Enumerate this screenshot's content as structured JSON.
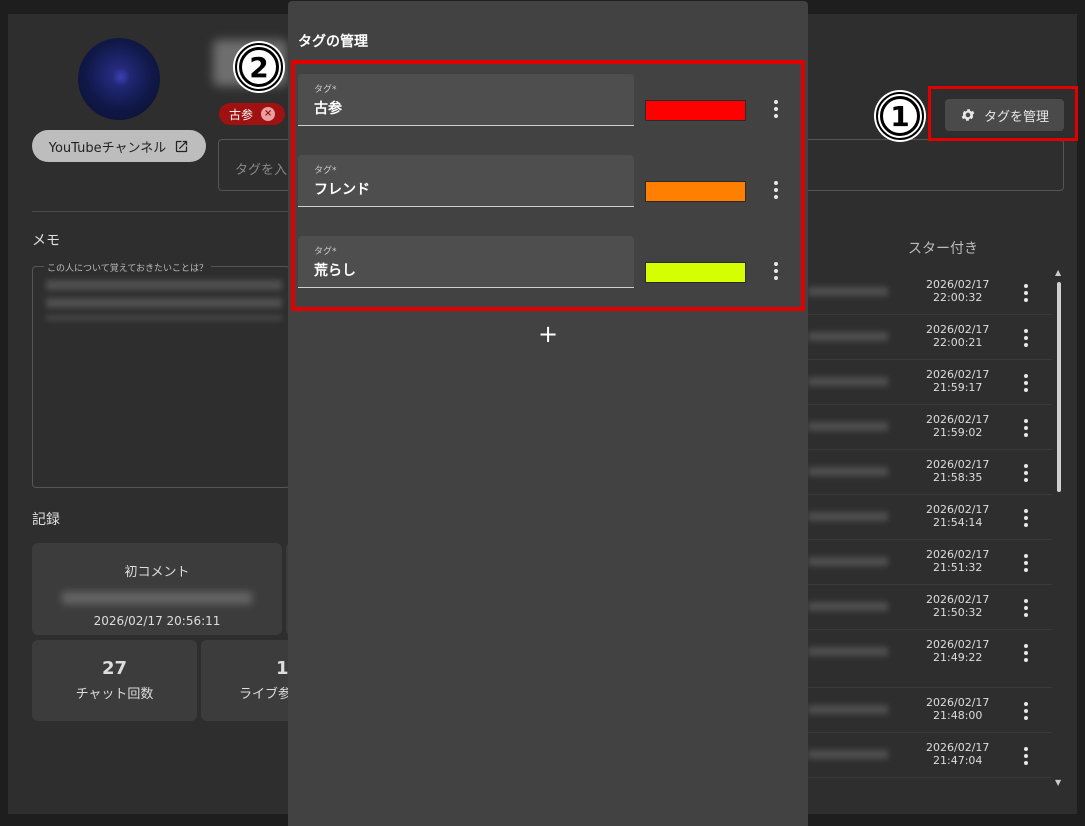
{
  "profile": {
    "tag_chip": "古参",
    "youtube_button": "YouTubeチャンネル",
    "tag_input_placeholder": "タグを入力"
  },
  "manage_button": "タグを管理",
  "annotations": {
    "one": "1",
    "two": "2"
  },
  "memo": {
    "title": "メモ",
    "field_label": "この人について覚えておきたいことは？"
  },
  "record": {
    "title": "記録",
    "first_comment_label": "初コメント",
    "first_comment_date": "2026/02/17 20:56:11",
    "chat_count": "27",
    "chat_count_label": "チャット回数",
    "live_count": "1",
    "live_label": "ライブ参"
  },
  "list": {
    "header": "スター付き",
    "rows": [
      {
        "date": "2026/02/17",
        "time": "22:00:32"
      },
      {
        "date": "2026/02/17",
        "time": "22:00:21"
      },
      {
        "date": "2026/02/17",
        "time": "21:59:17"
      },
      {
        "date": "2026/02/17",
        "time": "21:59:02"
      },
      {
        "date": "2026/02/17",
        "time": "21:58:35"
      },
      {
        "date": "2026/02/17",
        "time": "21:54:14"
      },
      {
        "date": "2026/02/17",
        "time": "21:51:32"
      },
      {
        "date": "2026/02/17",
        "time": "21:50:32"
      },
      {
        "date": "2026/02/17",
        "time": "21:49:22"
      },
      {
        "date": "2026/02/17",
        "time": "21:48:00"
      },
      {
        "date": "2026/02/17",
        "time": "21:47:04"
      }
    ]
  },
  "dialog": {
    "title": "タグの管理",
    "field_label": "タグ*",
    "add_symbol": "+",
    "tags": [
      {
        "name": "古参",
        "color": "#ff0000"
      },
      {
        "name": "フレンド",
        "color": "#ff8000"
      },
      {
        "name": "荒らし",
        "color": "#d4ff00"
      }
    ]
  }
}
